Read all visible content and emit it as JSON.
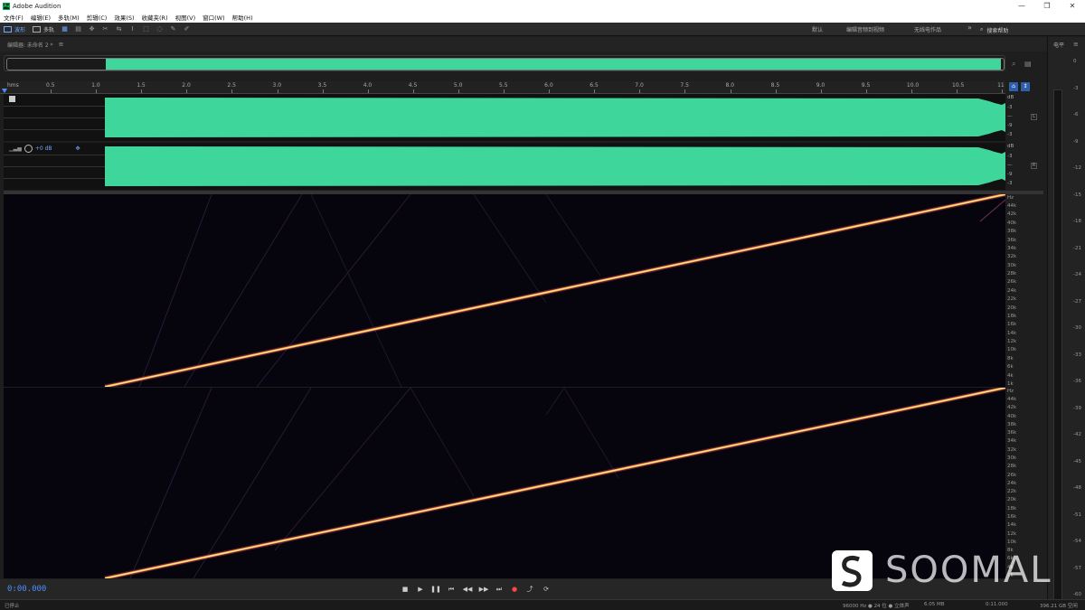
{
  "window": {
    "title": "Adobe Audition",
    "controls": [
      "—",
      "❐",
      "✕"
    ]
  },
  "menu": [
    "文件(F)",
    "编辑(E)",
    "多轨(M)",
    "剪辑(C)",
    "效果(S)",
    "收藏夹(R)",
    "视图(V)",
    "窗口(W)",
    "帮助(H)"
  ],
  "toolbar": {
    "waveform_label": "波形",
    "multitrack_label": "多轨",
    "workspaces": [
      "默认",
      "编辑音频到视频",
      "无线电作品"
    ],
    "more": "»",
    "search_placeholder": "搜索帮助"
  },
  "editor": {
    "title": "编辑器: 未命名 2 *",
    "menu_glyph": "≡"
  },
  "ruler": {
    "unit": "hms",
    "ticks": [
      "0.5",
      "1.0",
      "1.5",
      "2.0",
      "2.5",
      "3.0",
      "3.5",
      "4.0",
      "4.5",
      "5.0",
      "5.5",
      "6.0",
      "6.5",
      "7.0",
      "7.5",
      "8.0",
      "8.5",
      "9.0",
      "9.5",
      "10.0",
      "10.5",
      "11"
    ]
  },
  "channels": {
    "volume_label": "+0 dB",
    "db_unit": "dB",
    "db_ticks": [
      "-3",
      "-9",
      "-9",
      "-3"
    ],
    "left_badge": "L",
    "right_badge": "R"
  },
  "spectrum": {
    "hz_unit": "Hz",
    "hz_ticks": [
      "44k",
      "42k",
      "40k",
      "38k",
      "36k",
      "34k",
      "32k",
      "30k",
      "28k",
      "26k",
      "24k",
      "22k",
      "20k",
      "18k",
      "16k",
      "14k",
      "12k",
      "10k",
      "8k",
      "6k",
      "4k",
      "1k"
    ],
    "colors": {
      "background": "#06040d",
      "sweep_core": "#fff0a0",
      "sweep_glow": "#e0507a"
    }
  },
  "meter": {
    "title": "电平",
    "labels": [
      "0",
      "-3",
      "-6",
      "-9",
      "-12",
      "-15",
      "-18",
      "-21",
      "-24",
      "-27",
      "-30",
      "-33",
      "-36",
      "-39",
      "-42",
      "-45",
      "-48",
      "-51",
      "-54",
      "-57",
      "-60"
    ]
  },
  "transport": {
    "time": "0:00.000",
    "buttons": [
      "■",
      "▶",
      "❚❚",
      "⏮",
      "◀◀",
      "▶▶",
      "⏭",
      "●",
      "⤴",
      "⟳"
    ]
  },
  "status": {
    "left": "已停止",
    "sample_rate": "96000 Hz ● 24 位 ● 立体声",
    "file_size": "6.05 MB",
    "duration": "0:11.000",
    "free_space": "396.21 GB 空闲"
  },
  "watermark": {
    "text": "SOOMAL"
  },
  "colors": {
    "waveform": "#3fd69c",
    "accent": "#4d8fff"
  }
}
